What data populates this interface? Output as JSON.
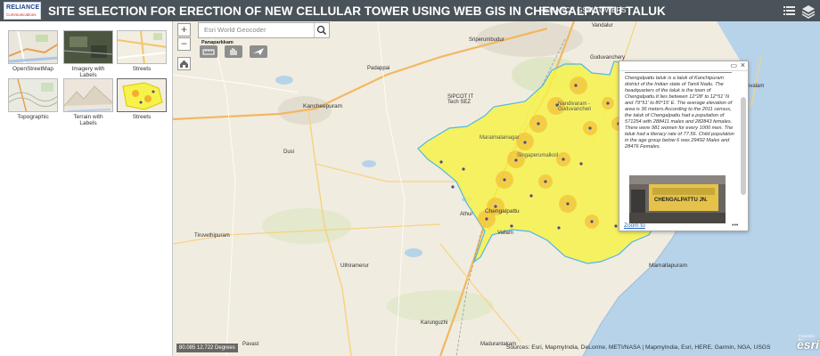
{
  "header": {
    "logo_line1": "RELIANCE",
    "logo_line2": "Communications",
    "title": "SITE SELECTION FOR ERECTION OF NEW CELLULAR TOWER USING WEB GIS IN CHENGALPATTU TALUK",
    "subtitle": "RELIANCE GSM TOWERS",
    "menu_icon": "list-icon",
    "layers_icon": "layers-icon",
    "color": "#4a5359"
  },
  "basemaps": [
    {
      "label": "OpenStreetMap",
      "icon": "osm-thumbnail"
    },
    {
      "label": "Imagery with\nLabels",
      "icon": "imagery-thumbnail"
    },
    {
      "label": "Streets",
      "icon": "streets-thumbnail"
    },
    {
      "label": "Topographic",
      "icon": "topo-thumbnail"
    },
    {
      "label": "Terrain with\nLabels",
      "icon": "terrain-thumbnail"
    },
    {
      "label": "Streets",
      "icon": "streets-selected-thumbnail"
    }
  ],
  "map": {
    "search_placeholder": "Esri World Geocoder",
    "toolbar_label": "Panaparkkam",
    "zoom_in": "+",
    "zoom_out": "−",
    "coordinates": "80.085 12.722 Degrees",
    "attribution": "Sources: Esri, MapmyIndia, DeLorme, METI/NASA | MapmyIndia, Esri, HERE, Garmin, NGA, USGS",
    "esri_logo": "esri",
    "esri_powered": "POWERED BY",
    "polygon_color": "#f7f24a",
    "places": [
      {
        "name": "Kancheepuram"
      },
      {
        "name": "Vandalur"
      },
      {
        "name": "Guduvanchery"
      },
      {
        "name": "Kovalam"
      },
      {
        "name": "Nandivaram -\nGuduvancheri"
      },
      {
        "name": "Maraimalainagar"
      },
      {
        "name": "Singaperumalkoil"
      },
      {
        "name": "Chengalpattu"
      },
      {
        "name": "Athur"
      },
      {
        "name": "Vallam"
      },
      {
        "name": "Tiruvethipuram"
      },
      {
        "name": "Uthiramerur"
      },
      {
        "name": "Karunguzhi"
      },
      {
        "name": "Madurantakam"
      },
      {
        "name": "Mamallapuram"
      },
      {
        "name": "Dusi"
      },
      {
        "name": "Sriperumbudur"
      },
      {
        "name": "Padappai"
      },
      {
        "name": "Pavast"
      },
      {
        "name": "SIPCOT IT\nTech SEZ"
      }
    ]
  },
  "popup": {
    "text": "Chengalpattu taluk is a taluk of Kanchipuram district of the Indian state of Tamil Nadu. The headquarters of the taluk is the town of Chengalpattu.It lies between 12°28' to 12°51' N and 79°51' to 80°15' E. The average elevation of area is 36 meters.According to the 2011 census, the taluk of Chengalpattu had a population of 571254 with 288411 males and 282843 females. There were 981 women for every 1000 men. The taluk had a literacy rate of 77.56. Child population in the age group below 6 was 29492 Males and 28476 Females.",
    "zoom_to": "Zoom to",
    "more": "•••",
    "maximize_icon": "maximize-icon",
    "close_icon": "close-icon",
    "station_sign": "CHENGALPATTU JN."
  }
}
